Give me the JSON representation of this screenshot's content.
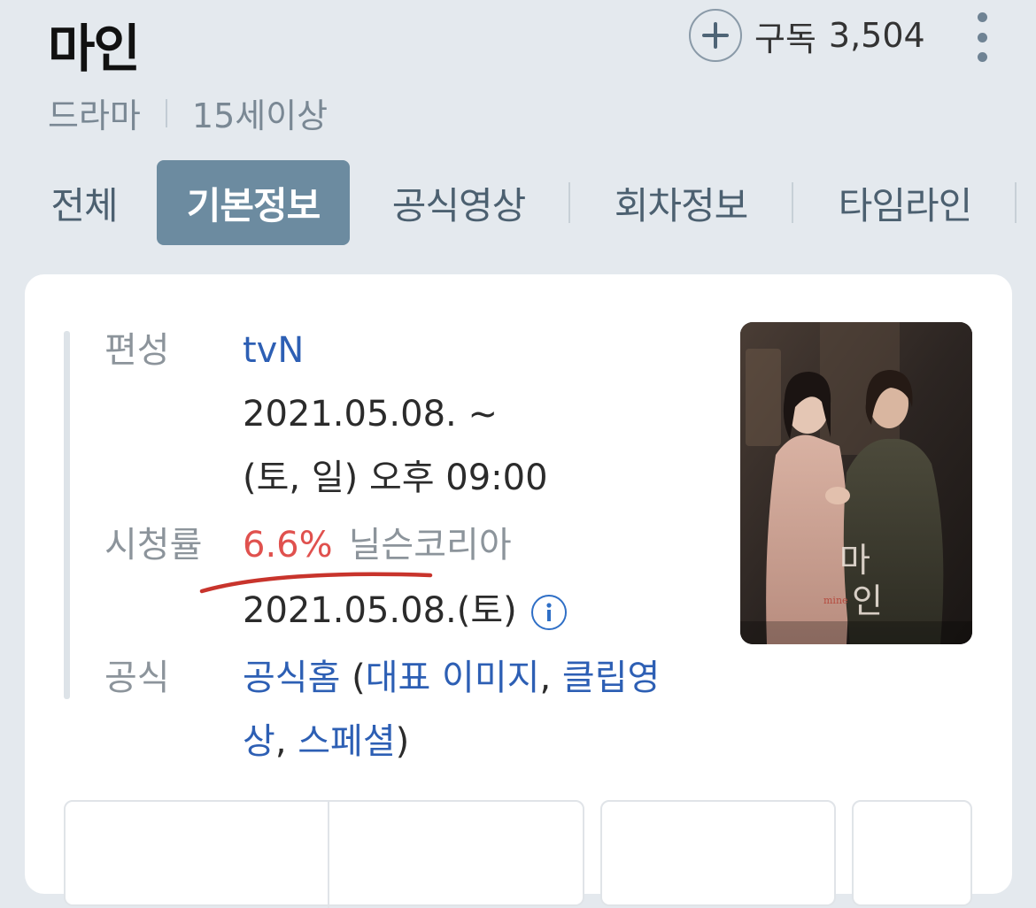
{
  "header": {
    "title": "마인",
    "subscribe_label": "구독",
    "subscribe_count": "3,504",
    "genre": "드라마",
    "age_rating": "15세이상"
  },
  "tabs": [
    {
      "label": "전체",
      "active": false
    },
    {
      "label": "기본정보",
      "active": true
    },
    {
      "label": "공식영상",
      "active": false
    },
    {
      "label": "회차정보",
      "active": false
    },
    {
      "label": "타임라인",
      "active": false
    }
  ],
  "info": {
    "channel_label": "편성",
    "channel": "tvN",
    "airing_dates": "2021.05.08. ~",
    "airing_time": "(토, 일) 오후 09:00",
    "rating_label": "시청률",
    "rating_value": "6.6%",
    "rating_source": "닐슨코리아",
    "rating_date": "2021.05.08.(토)",
    "official_label": "공식",
    "official_home": "공식홈",
    "official_paren_open": " (",
    "official_image": "대표 이미지",
    "official_comma1": ", ",
    "official_clip_a": "클립영",
    "official_clip_b": "상",
    "official_comma2": ", ",
    "official_special": "스페셜",
    "official_paren_close": ")"
  },
  "poster": {
    "title_char_1": "마",
    "title_char_2": "인",
    "english": "mine"
  },
  "colors": {
    "active_tab": "#6c8ba0",
    "link": "#2d5fb4",
    "rating": "#e0514e",
    "underline_annotation": "#c8342c"
  },
  "icons": [
    "plus-circle-icon",
    "more-vertical-icon",
    "info-circle-icon"
  ]
}
